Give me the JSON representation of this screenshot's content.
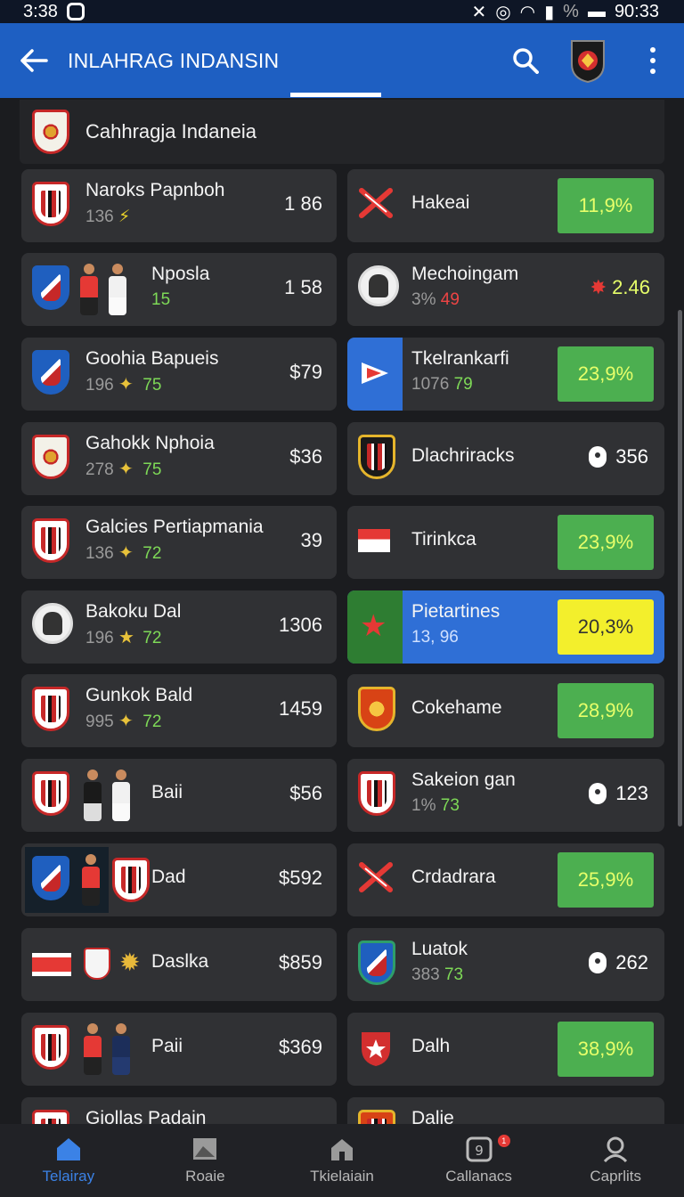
{
  "status": {
    "time": "3:38",
    "right_time": "90:33",
    "battery_text": "%"
  },
  "appbar": {
    "title": "INLAHRAG INDANSIN"
  },
  "section": {
    "title": "Cahhragja Indaneia"
  },
  "left_cards": [
    {
      "name": "Naroks Papnboh",
      "sub": "136",
      "val": "1 86"
    },
    {
      "name": "Nposla",
      "sub_g": "15",
      "val": "1 58"
    },
    {
      "name": "Goohia Bapueis",
      "sub": "196",
      "sub_g": "75",
      "val": "$79"
    },
    {
      "name": "Gahokk Nphoia",
      "sub": "278",
      "sub_g": "75",
      "val": "$36"
    },
    {
      "name": "Galcies Pertiapmania",
      "sub": "136",
      "sub_g": "72",
      "val": "39"
    },
    {
      "name": "Bakoku Dal",
      "sub": "196",
      "sub_g": "72",
      "val": "1306"
    },
    {
      "name": "Gunkok Bald",
      "sub": "995",
      "sub_g": "72",
      "val": "1459"
    },
    {
      "name": "Baii",
      "val": "$56"
    },
    {
      "name": "Dad",
      "val": "$592"
    },
    {
      "name": "Daslka",
      "val": "$859"
    },
    {
      "name": "Paii",
      "val": "$369"
    },
    {
      "name": "Giollas Padain"
    }
  ],
  "right_cards": [
    {
      "name": "Hakeai",
      "pct": "11,9%"
    },
    {
      "name": "Mechoingam",
      "sub": "3%",
      "sub_r": "49",
      "val": "2.46"
    },
    {
      "name": "Tkelrankarfi",
      "sub": "1076",
      "sub_g": "79",
      "pct": "23,9%"
    },
    {
      "name": "Dlachriracks",
      "pin": "356"
    },
    {
      "name": "Tirinkca",
      "pct": "23,9%"
    },
    {
      "name": "Pietartines",
      "sub": "13, 96",
      "pct": "20,3%"
    },
    {
      "name": "Cokehame",
      "pct": "28,9%"
    },
    {
      "name": "Sakeion gan",
      "sub": "1%",
      "sub_g": "73",
      "pin": "123"
    },
    {
      "name": "Crdadrara",
      "pct": "25,9%"
    },
    {
      "name": "Luatok",
      "sub": "383",
      "sub_g": "73",
      "pin": "262"
    },
    {
      "name": "Dalh",
      "pct": "38,9%"
    },
    {
      "name": "Dalie"
    }
  ],
  "bottom_nav": [
    {
      "label": "Telairay",
      "icon": "home-icon"
    },
    {
      "label": "Roaie",
      "icon": "image-icon"
    },
    {
      "label": "Tkielaiain",
      "icon": "home-outline-icon"
    },
    {
      "label": "Callanacs",
      "icon": "calendar-icon",
      "badge": "1"
    },
    {
      "label": "Caprlits",
      "icon": "profile-icon"
    }
  ]
}
